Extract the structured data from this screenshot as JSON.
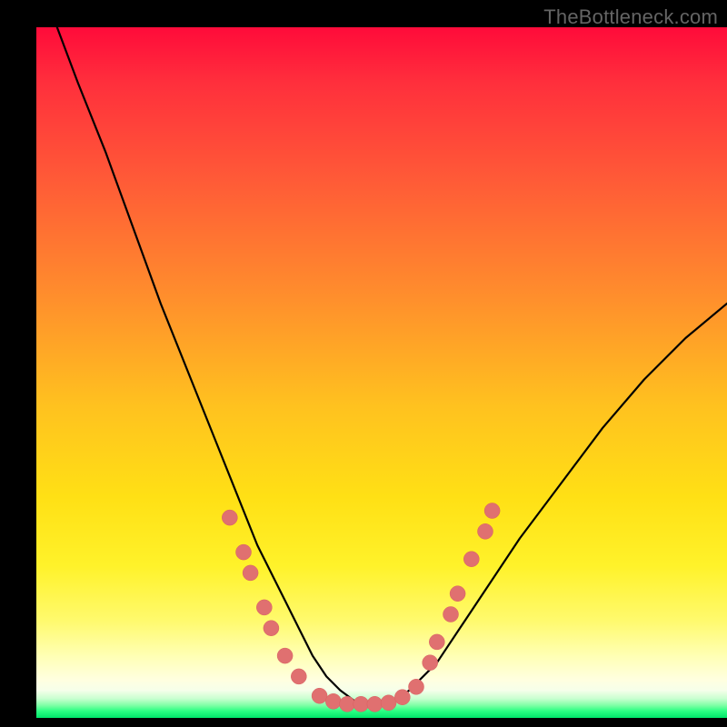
{
  "watermark": "TheBottleneck.com",
  "colors": {
    "frame": "#000000",
    "watermark_text": "#646464",
    "curve_stroke": "#000000",
    "dot_fill": "#e07070",
    "gradient_stops": [
      "#ff0b3a",
      "#ff2f3c",
      "#ff5a37",
      "#ff8b2d",
      "#ffc21f",
      "#ffe015",
      "#fff22a",
      "#fffa6e",
      "#ffffb4",
      "#ffffe0",
      "#f6ffea",
      "#c9ffd0",
      "#7dffa5",
      "#2bff82",
      "#00e56a"
    ]
  },
  "chart_data": {
    "type": "line",
    "title": "",
    "xlabel": "",
    "ylabel": "",
    "xlim": [
      0,
      100
    ],
    "ylim": [
      0,
      100
    ],
    "axes_visible": false,
    "grid": false,
    "legend": false,
    "note": "V-shaped curve over a vertical heat gradient. No tick labels or axis text are rendered. Curve values estimated from pixel positions; y=0 is bottom (green), y=100 is top (red).",
    "series": [
      {
        "name": "curve",
        "x": [
          3,
          6,
          10,
          14,
          18,
          22,
          26,
          28,
          30,
          32,
          34,
          36,
          38,
          40,
          42,
          44,
          46,
          48,
          50,
          52,
          54,
          58,
          62,
          66,
          70,
          76,
          82,
          88,
          94,
          100
        ],
        "y": [
          100,
          92,
          82,
          71,
          60,
          50,
          40,
          35,
          30,
          25,
          21,
          17,
          13,
          9,
          6,
          4,
          2.5,
          2,
          2,
          2.5,
          4,
          8,
          14,
          20,
          26,
          34,
          42,
          49,
          55,
          60
        ]
      }
    ],
    "markers": {
      "name": "highlight-dots",
      "note": "Salmon-colored dots clustered along the lower portion of both arms and across the trough.",
      "points": [
        {
          "x": 28,
          "y": 29
        },
        {
          "x": 30,
          "y": 24
        },
        {
          "x": 31,
          "y": 21
        },
        {
          "x": 33,
          "y": 16
        },
        {
          "x": 34,
          "y": 13
        },
        {
          "x": 36,
          "y": 9
        },
        {
          "x": 38,
          "y": 6
        },
        {
          "x": 41,
          "y": 3.2
        },
        {
          "x": 43,
          "y": 2.4
        },
        {
          "x": 45,
          "y": 2
        },
        {
          "x": 47,
          "y": 2
        },
        {
          "x": 49,
          "y": 2
        },
        {
          "x": 51,
          "y": 2.2
        },
        {
          "x": 53,
          "y": 3
        },
        {
          "x": 55,
          "y": 4.5
        },
        {
          "x": 57,
          "y": 8
        },
        {
          "x": 58,
          "y": 11
        },
        {
          "x": 60,
          "y": 15
        },
        {
          "x": 61,
          "y": 18
        },
        {
          "x": 63,
          "y": 23
        },
        {
          "x": 65,
          "y": 27
        },
        {
          "x": 66,
          "y": 30
        }
      ]
    }
  }
}
